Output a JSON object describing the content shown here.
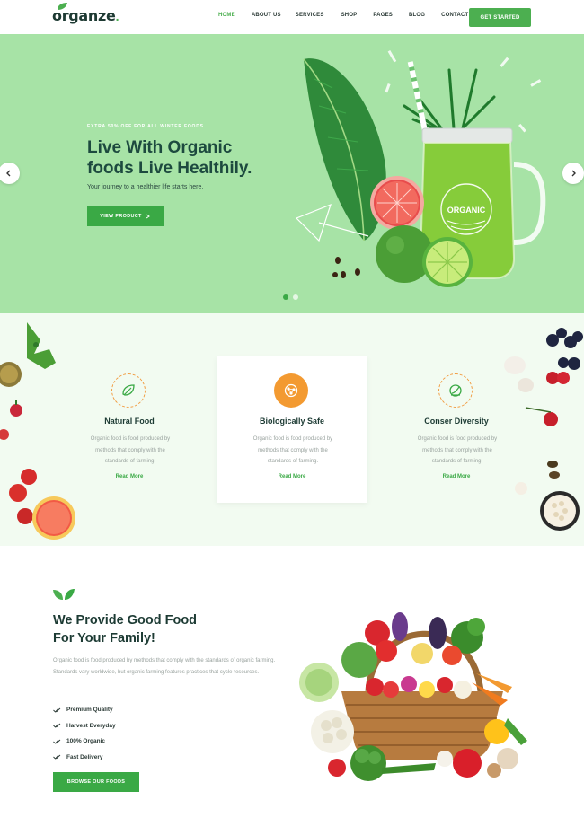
{
  "brand": {
    "name": "organze",
    "accent": "#4caf50",
    "hero_bg": "#a7e3a6",
    "feature_bg": "#f2fbf1",
    "icon_accent": "#f39a31"
  },
  "nav": {
    "items": [
      {
        "label": "HOME",
        "active": true
      },
      {
        "label": "ABOUT US"
      },
      {
        "label": "SERVICES"
      },
      {
        "label": "SHOP"
      },
      {
        "label": "PAGES"
      },
      {
        "label": "BLOG"
      },
      {
        "label": "CONTACT"
      }
    ],
    "cta": "GET STARTED"
  },
  "hero": {
    "kicker": "EXTRA 50% OFF FOR ALL WINTER FOODS",
    "title_line1": "Live With Organic",
    "title_line2": "foods Live Healthily.",
    "subtitle": "Your journey to a healthier life starts here.",
    "button": "VIEW PRODUCT",
    "button_icon": "arrow-right-icon",
    "prev_icon": "chevron-left-icon",
    "next_icon": "chevron-right-icon",
    "jar_label": "ORGANIC",
    "slides": 2,
    "active_slide": 1
  },
  "features": [
    {
      "title": "Natural Food",
      "text": "Organic food is food produced by methods that comply with the standards of farming.",
      "link": "Read More",
      "icon": "leaf-food-icon"
    },
    {
      "title": "Biologically Safe",
      "text": "Organic food is food produced by methods that comply with the standards of farming.",
      "link": "Read More",
      "icon": "bio-molecule-icon"
    },
    {
      "title": "Conser Diversity",
      "text": "Organic food is food produced by methods that comply with the standards of farming.",
      "link": "Read More",
      "icon": "eco-globe-icon"
    }
  ],
  "about": {
    "title_line1": "We Provide Good Food",
    "title_line2": "For Your Family!",
    "text": "Organic food is food produced by methods that comply with the standards of organic farming. Standards vary worldwide, but organic farming features practices that cycle resources.",
    "list": [
      "Premium Quality",
      "Harvest Everyday",
      "100% Organic",
      "Fast Delivery"
    ],
    "button": "BROWSE OUR FOODS"
  }
}
